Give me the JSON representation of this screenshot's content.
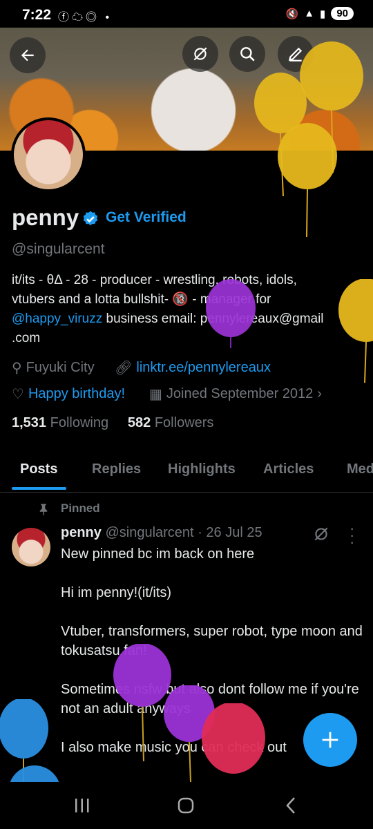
{
  "status": {
    "time": "7:22",
    "battery": "90"
  },
  "profile": {
    "name": "penny",
    "get_verified": "Get Verified",
    "handle": "@singularcent",
    "bio_line1": "it/its - θΔ - 28 - producer - wrestling, robots, idols,",
    "bio_line2": "vtubers and a lotta bullshit- 🔞 - manager for",
    "bio_mention": "@happy_viruzz",
    "bio_line3b": " business email: pennylereaux@gmail",
    "bio_line4": ".com",
    "location": "Fuyuki City",
    "link": "linktr.ee/pennylereaux",
    "birthday": "Happy birthday!",
    "joined": "Joined September 2012",
    "following_count": "1,531",
    "following_label": "Following",
    "followers_count": "582",
    "followers_label": "Followers"
  },
  "tabs": [
    "Posts",
    "Replies",
    "Highlights",
    "Articles",
    "Med"
  ],
  "post": {
    "pinned_label": "Pinned",
    "author": "penny",
    "author_handle": "@singularcent",
    "date": "· 26 Jul 25",
    "lines": [
      "New pinned bc im back on here",
      "Hi im penny!(it/its)",
      "Vtuber, transformers, super robot, type moon and tokusatsu fan!",
      "Sometimes nsfw but also dont follow me if you're not an adult anyways",
      "I also make music you can check out"
    ]
  },
  "colors": {
    "accent": "#1d9bf0",
    "muted": "#71767b",
    "text": "#e7e9ea"
  }
}
